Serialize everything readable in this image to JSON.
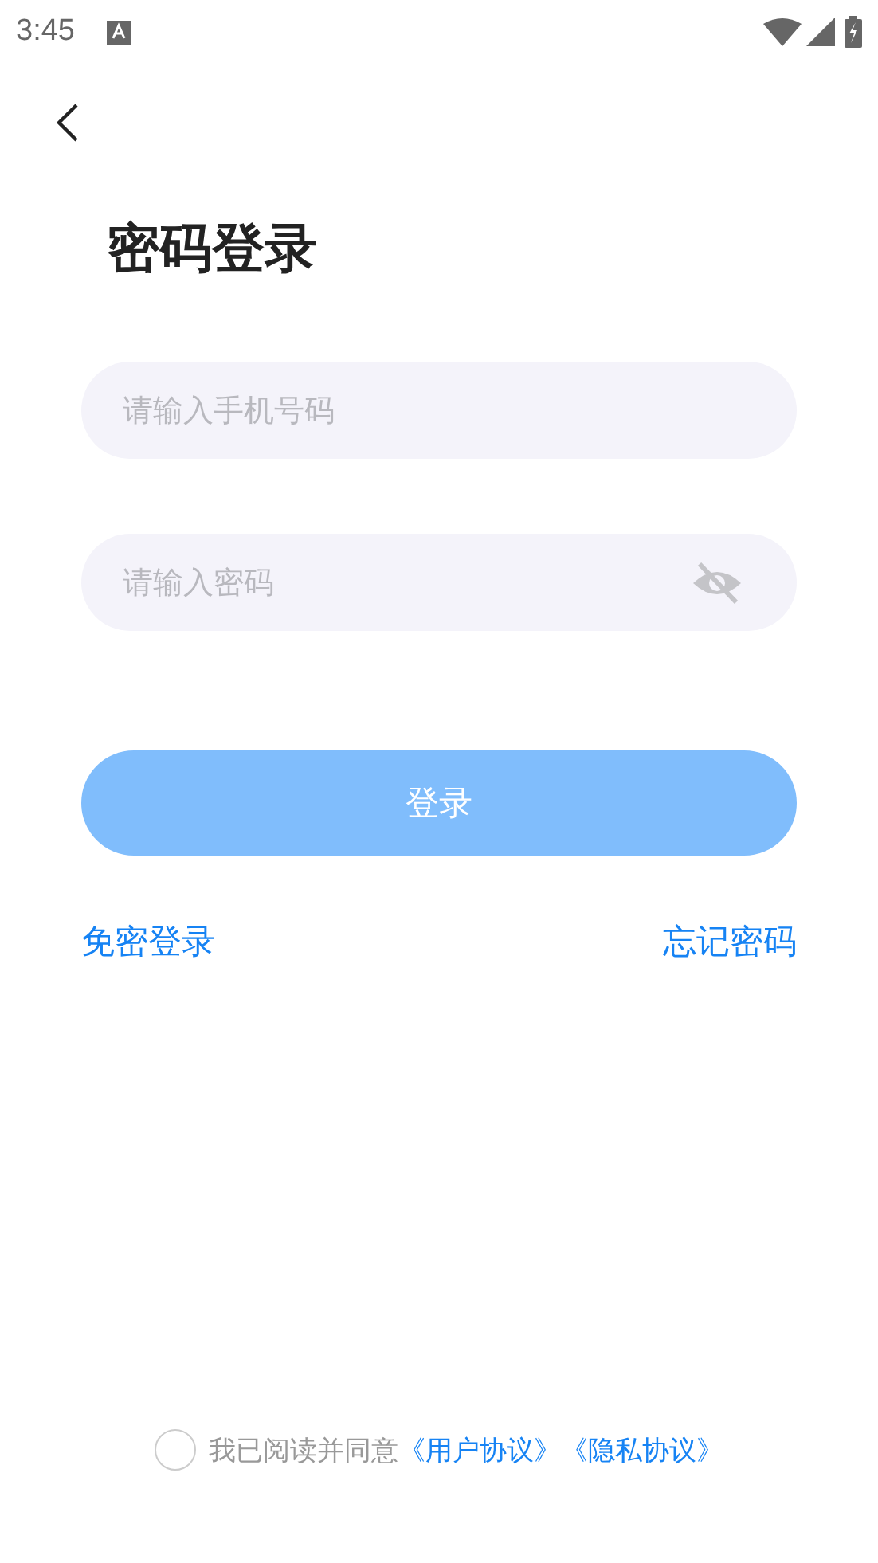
{
  "status_bar": {
    "time": "3:45"
  },
  "title": "密码登录",
  "fields": [
    {
      "kind": "phone",
      "placeholder": "请输入手机号码"
    },
    {
      "kind": "password",
      "placeholder": "请输入密码",
      "password_visible": false
    }
  ],
  "login_button": {
    "label": "登录",
    "disabled": true
  },
  "links": [
    {
      "label": "免密登录"
    },
    {
      "label": "忘记密码"
    }
  ],
  "agreement": {
    "checked": false,
    "text": "我已阅读并同意",
    "links": [
      "《用户协议》",
      "《隐私协议》"
    ]
  }
}
